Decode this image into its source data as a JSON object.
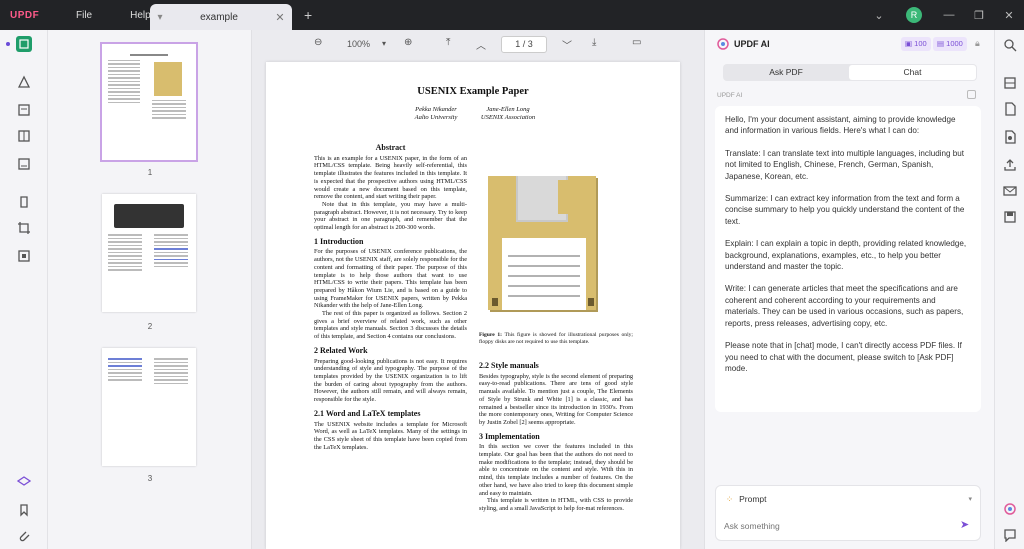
{
  "app": {
    "logo": "UPDF"
  },
  "menu": [
    {
      "label": "File"
    },
    {
      "label": "Help"
    }
  ],
  "tabs": [
    {
      "label": "example"
    }
  ],
  "user": {
    "initial": "R"
  },
  "thumbnails": [
    {
      "number": "1"
    },
    {
      "number": "2"
    },
    {
      "number": "3"
    }
  ],
  "toolbar": {
    "zoom": "100%",
    "page_current": "1",
    "page_sep": "/",
    "page_total": "3"
  },
  "paper": {
    "title": "USENIX Example Paper",
    "author1_name": "Pekka Nikander",
    "author1_org": "Aalto University",
    "author2_name": "Jane-Ellen Long",
    "author2_org": "USENIX Association",
    "abstract_heading": "Abstract",
    "abstract_p1": "This is an example for a USENIX paper, in the form of an HTML/CSS template. Being heavily self-referential, this template illustrates the features included in this template. It is expected that the prospective authors using HTML/CSS would create a new document based on this template, remove the content, and start writing their paper.",
    "abstract_p2": "Note that in this template, you may have a multi-paragraph abstract. However, it is not necessary. Try to keep your abstract in one paragraph, and remember that the optimal length for an abstract is 200-300 words.",
    "s1_heading": "1 Introduction",
    "s1_p1": "For the purposes of USENIX conference publications, the authors, not the USENIX staff, are solely responsible for the content and formatting of their paper. The purpose of this template is to help those authors that want to use HTML/CSS to write their papers. This template has been prepared by Håkon Wium Lie, and is based on a guide to using FrameMaker for USENIX papers, written by Pekka Nikander with the help of Jane-Ellen Long.",
    "s1_p2": "The rest of this paper is organized as follows. Section 2 gives a brief overview of related work, such as other templates and style manuals. Section 3 discusses the details of this template, and Section 4 contains our conclusions.",
    "s2_heading": "2 Related Work",
    "s2_p1": "Preparing good-looking publications is not easy. It requires understanding of style and typography. The purpose of the templates provided by the USENIX organization is to lift the burden of caring about typography from the authors. However, the authors still remain, and will always remain, responsible for the style.",
    "s21_heading": "2.1 Word and LaTeX templates",
    "s21_p1": "The USENIX website includes a template for Microsoft Word, as well as LaTeX templates. Many of the settings in the CSS style sheet of this template have been copied from the LaTeX templates.",
    "figure_caption_label": "Figure 1:",
    "figure_caption": " This figure is showed for illustrational purposes only; floppy disks are not required to use this template.",
    "s22_heading": "2.2 Style manuals",
    "s22_p1": "Besides typography, style is the second element of preparing easy-to-read publications. There are tens of good style manuals available. To mention just a couple, The Elements of Style by Strunk and White [1] is a classic, and has remained a bestseller since its introduction in 1930's. From the more contemporary ones, Writing for Computer Science by Justin Zobel [2] seems appropriate.",
    "s3_heading": "3 Implementation",
    "s3_p1": "In this section we cover the features included in this template. Our goal has been that the authors do not need to make modifications to the template; instead, they should be able to concentrate on the content and style. With this in mind, this template includes a number of features. On the other hand, we have also tried to keep this document simple and easy to maintain.",
    "s3_p2": "This template is written in HTML, with CSS to provide styling, and a small JavaScript to help for-mat references."
  },
  "ai": {
    "title": "UPDF AI",
    "credits1": "100",
    "credits2": "1000",
    "tab_ask": "Ask PDF",
    "tab_chat": "Chat",
    "sender": "UPDF AI",
    "messages": [
      "Hello, I'm your document assistant, aiming to provide knowledge and information in various fields. Here's what I can do:",
      "Translate: I can translate text into multiple languages, including but not limited to English, Chinese, French, German, Spanish, Japanese, Korean, etc.",
      "Summarize: I can extract key information from the text and form a concise summary to help you quickly understand the content of the text.",
      "Explain: I can explain a topic in depth, providing related knowledge, background, explanations, examples, etc., to help you better understand and master the topic.",
      "Write: I can generate articles that meet the specifications and are coherent and coherent according to your requirements and materials. They can be used in various occasions, such as papers, reports, press releases, advertising copy, etc.",
      "Please note that in [chat] mode, I can't directly access PDF files. If you need to chat with the document, please switch to [Ask PDF] mode."
    ],
    "prompt_label": "Prompt",
    "input_placeholder": "Ask something"
  },
  "colors": {
    "accent": "#7b4fd6",
    "titlebar": "#222326",
    "floppy_body": "#d8bd6e"
  }
}
